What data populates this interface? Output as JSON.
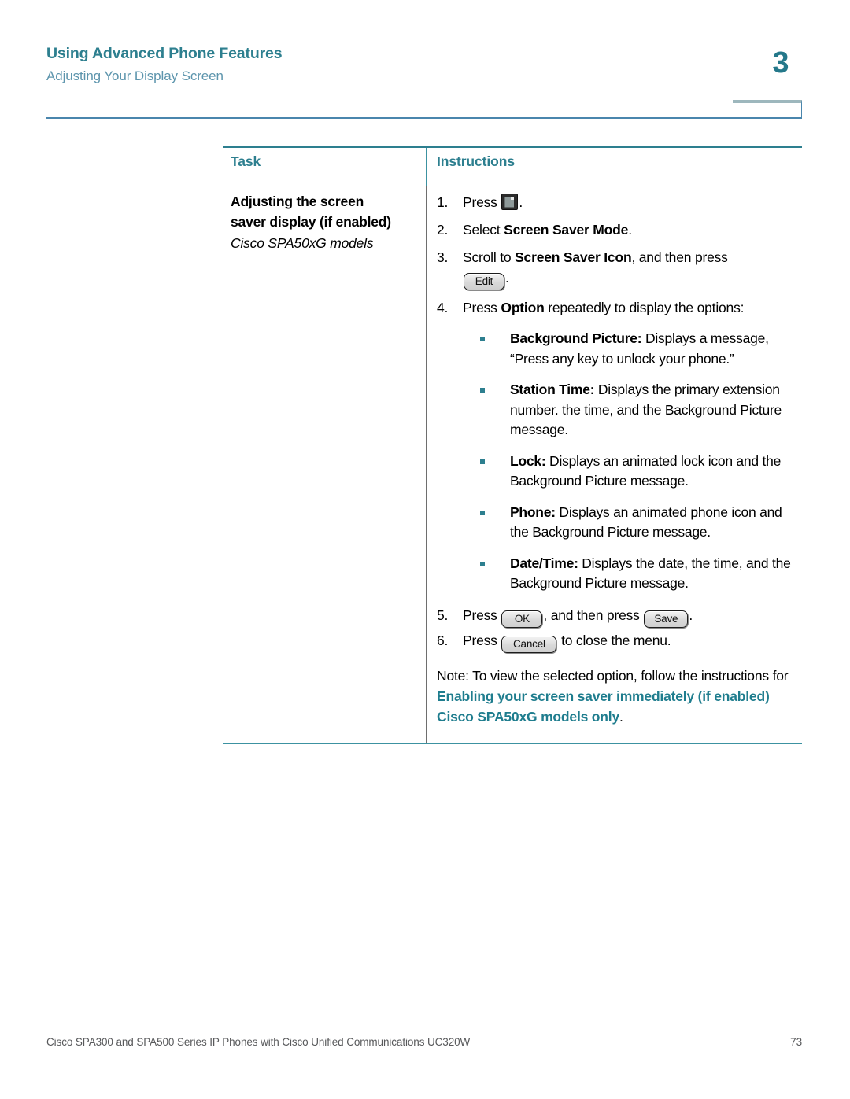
{
  "header": {
    "title": "Using Advanced Phone Features",
    "subtitle": "Adjusting Your Display Screen",
    "chapter_number": "3",
    "accent_color": "#2d7f8f",
    "subtitle_color": "#5d95ad"
  },
  "table": {
    "columns": {
      "task": "Task",
      "instructions": "Instructions"
    },
    "task_cell": {
      "title_line1": "Adjusting the screen",
      "title_line2": "saver display (if enabled)",
      "subtitle": "Cisco SPA50xG models"
    },
    "steps": [
      {
        "number": "1.",
        "prefix": "Press ",
        "icon": "setup-page-icon",
        "suffix": "."
      },
      {
        "number": "2.",
        "prefix": "Select ",
        "bold": "Screen Saver Mode",
        "suffix": "."
      },
      {
        "number": "3.",
        "prefix": "Scroll to ",
        "bold": "Screen Saver Icon",
        "mid": ", and then press ",
        "button": "Edit",
        "suffix": "."
      },
      {
        "number": "4.",
        "prefix": "Press ",
        "bold": "Option",
        "suffix": " repeatedly to display the options:"
      },
      {
        "number": "5.",
        "prefix": "Press ",
        "button1": "OK",
        "mid": ", and then press ",
        "button2": "Save",
        "suffix": "."
      },
      {
        "number": "6.",
        "prefix": "Press ",
        "button": "Cancel",
        "suffix": " to close the menu."
      }
    ],
    "options": [
      {
        "term": "Background Picture:",
        "description": " Displays a message, “Press any key to unlock your phone.”"
      },
      {
        "term": "Station Time:",
        "description": " Displays the primary extension number. the time, and the Background Picture message."
      },
      {
        "term": "Lock:",
        "description": " Displays an animated lock icon and the Background Picture message."
      },
      {
        "term": "Phone:",
        "description": " Displays an animated phone icon and the Background Picture message."
      },
      {
        "term": "Date/Time:",
        "description": " Displays the date, the time, and the Background Picture message."
      }
    ],
    "note": {
      "plain_prefix": "Note: To view the selected option, follow the instructions for ",
      "link_text": "Enabling your screen saver immediately (if enabled) Cisco SPA50xG models only",
      "plain_suffix": "."
    }
  },
  "footer": {
    "document_title": "Cisco SPA300 and SPA500 Series IP Phones with Cisco Unified Communications UC320W",
    "page_number": "73"
  }
}
